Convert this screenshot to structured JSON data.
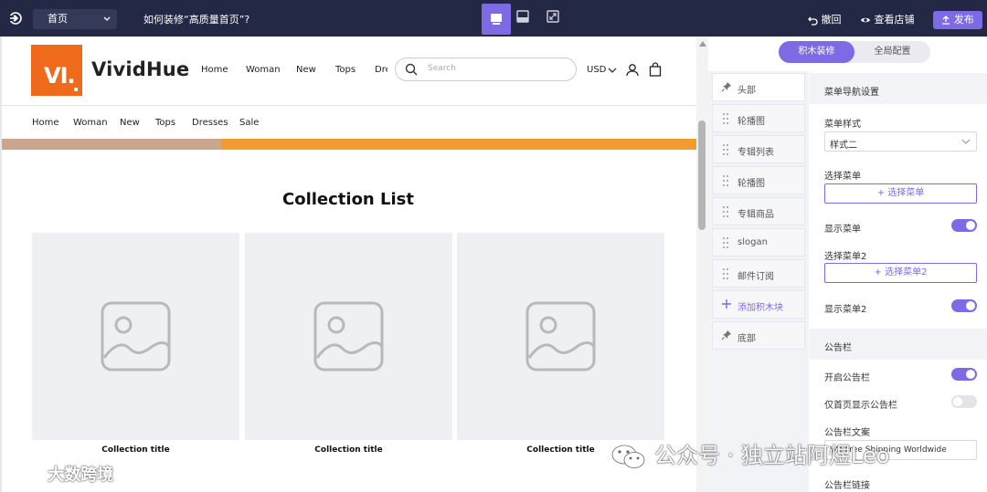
{
  "topbar": {
    "page_select": "首页",
    "title": "如何装修“高质量首页”?",
    "undo": "撤回",
    "view_store": "查看店铺",
    "publish": "发布"
  },
  "store": {
    "logo_text": "VI.",
    "brand": "VividHue",
    "nav_primary": [
      "Home",
      "Woman",
      "New",
      "Tops",
      "Dre"
    ],
    "search_placeholder": "Search",
    "currency": "USD",
    "nav_secondary": [
      "Home",
      "Woman",
      "New",
      "Tops",
      "Dresses",
      "Sale"
    ],
    "collection_heading": "Collection List",
    "collections": [
      {
        "title": "Collection title"
      },
      {
        "title": "Collection title"
      },
      {
        "title": "Collection title"
      }
    ]
  },
  "panel": {
    "tabs": [
      "积木装修",
      "全局配置"
    ],
    "blocks": [
      {
        "label": "头部",
        "kind": "pinned",
        "active": true
      },
      {
        "label": "轮播图",
        "kind": "drag"
      },
      {
        "label": "专辑列表",
        "kind": "drag"
      },
      {
        "label": "轮播图",
        "kind": "drag"
      },
      {
        "label": "专辑商品",
        "kind": "drag"
      },
      {
        "label": "slogan",
        "kind": "drag"
      },
      {
        "label": "邮件订阅",
        "kind": "drag"
      },
      {
        "label": "添加积木块",
        "kind": "add"
      },
      {
        "label": "底部",
        "kind": "pinned"
      }
    ],
    "settings": {
      "menu_nav_header": "菜单导航设置",
      "menu_style_label": "菜单样式",
      "menu_style_value": "样式二",
      "select_menu_label": "选择菜单",
      "select_menu_btn": "+ 选择菜单",
      "show_menu_label": "显示菜单",
      "show_menu_on": true,
      "select_menu2_label": "选择菜单2",
      "select_menu2_btn": "+ 选择菜单2",
      "show_menu2_label": "显示菜单2",
      "show_menu2_on": true,
      "announcement_header": "公告栏",
      "enable_announcement_label": "开启公告栏",
      "enable_announcement_on": true,
      "home_only_label": "仅首页显示公告栏",
      "home_only_on": false,
      "announcement_text_label": "公告栏文案",
      "announcement_text_value": "We Free Shipping Worldwide",
      "announcement_link_label": "公告栏链接"
    }
  },
  "watermarks": {
    "left": "大数跨境",
    "right": "公众号 · 独立站阿煜Leo"
  },
  "colors": {
    "topbar_bg": "#232845",
    "accent": "#7f6ae6",
    "logo_orange": "#f06a1c"
  }
}
